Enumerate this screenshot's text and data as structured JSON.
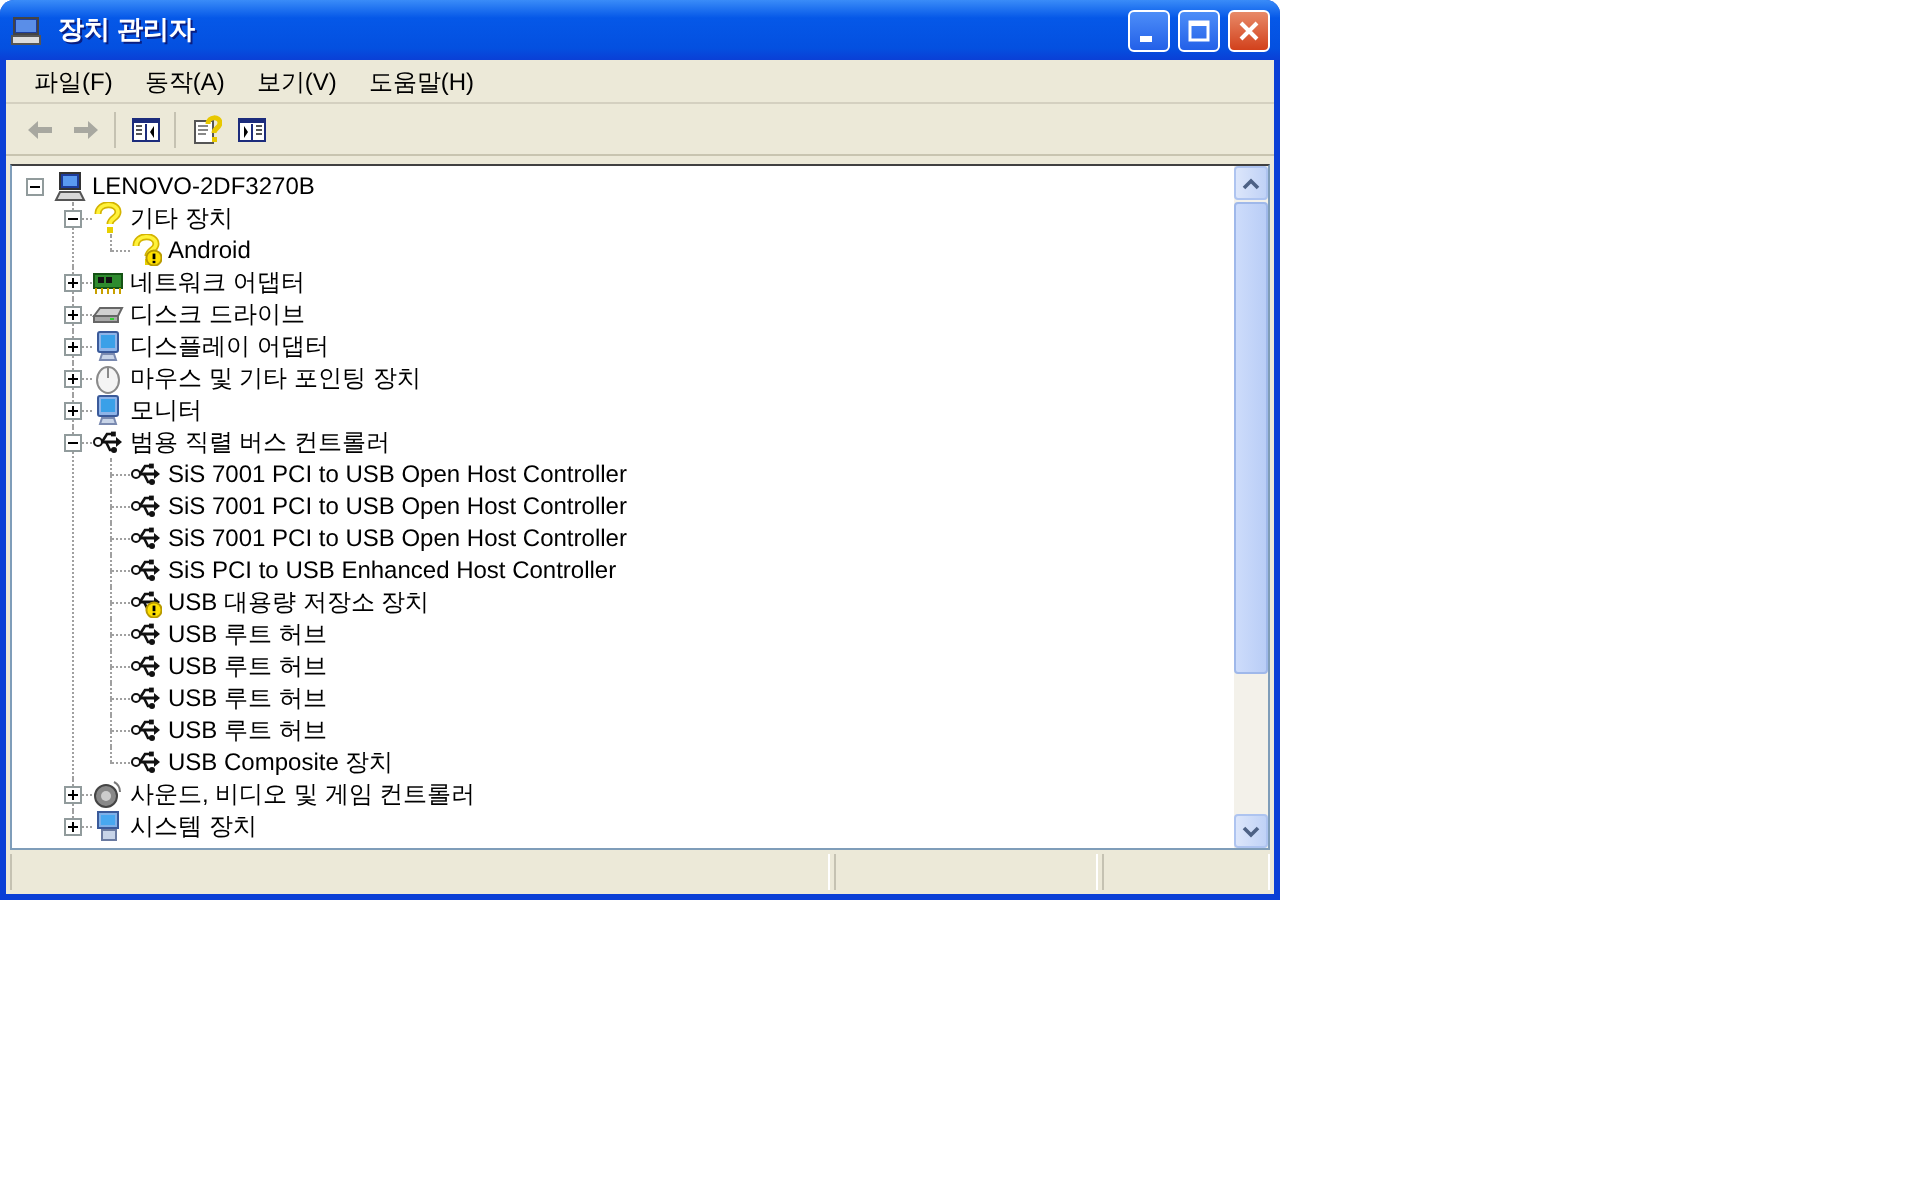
{
  "window": {
    "title": "장치 관리자"
  },
  "menu": [
    "파일(F)",
    "동작(A)",
    "보기(V)",
    "도움말(H)"
  ],
  "toolbar": [
    {
      "kind": "back",
      "disabled": true
    },
    {
      "kind": "forward",
      "disabled": true
    },
    {
      "kind": "sep"
    },
    {
      "kind": "tree-toggle"
    },
    {
      "kind": "sep"
    },
    {
      "kind": "properties"
    },
    {
      "kind": "update"
    }
  ],
  "tree": [
    {
      "label": "LENOVO-2DF3270B",
      "kind": "computer",
      "expanded": true,
      "children": [
        {
          "label": "기타 장치",
          "kind": "unknown",
          "expanded": true,
          "children": [
            {
              "label": "Android",
              "kind": "unknown",
              "warning": true
            }
          ]
        },
        {
          "label": "네트워크 어댑터",
          "kind": "network",
          "expanded": false
        },
        {
          "label": "디스크 드라이브",
          "kind": "disk",
          "expanded": false
        },
        {
          "label": "디스플레이 어댑터",
          "kind": "display",
          "expanded": false
        },
        {
          "label": "마우스 및 기타 포인팅 장치",
          "kind": "mouse",
          "expanded": false
        },
        {
          "label": "모니터",
          "kind": "display",
          "expanded": false
        },
        {
          "label": "범용 직렬 버스 컨트롤러",
          "kind": "usb",
          "expanded": true,
          "children": [
            {
              "label": "SiS 7001 PCI to USB Open Host Controller",
              "kind": "usb"
            },
            {
              "label": "SiS 7001 PCI to USB Open Host Controller",
              "kind": "usb"
            },
            {
              "label": "SiS 7001 PCI to USB Open Host Controller",
              "kind": "usb"
            },
            {
              "label": "SiS PCI to USB Enhanced Host Controller",
              "kind": "usb"
            },
            {
              "label": "USB 대용량 저장소 장치",
              "kind": "usb",
              "warning": true
            },
            {
              "label": "USB 루트 허브",
              "kind": "usb"
            },
            {
              "label": "USB 루트 허브",
              "kind": "usb"
            },
            {
              "label": "USB 루트 허브",
              "kind": "usb"
            },
            {
              "label": "USB 루트 허브",
              "kind": "usb"
            },
            {
              "label": "USB Composite 장치",
              "kind": "usb"
            }
          ]
        },
        {
          "label": "사운드, 비디오 및 게임 컨트롤러",
          "kind": "sound",
          "expanded": false
        },
        {
          "label": "시스템 장치",
          "kind": "system",
          "expanded": false
        }
      ]
    }
  ]
}
